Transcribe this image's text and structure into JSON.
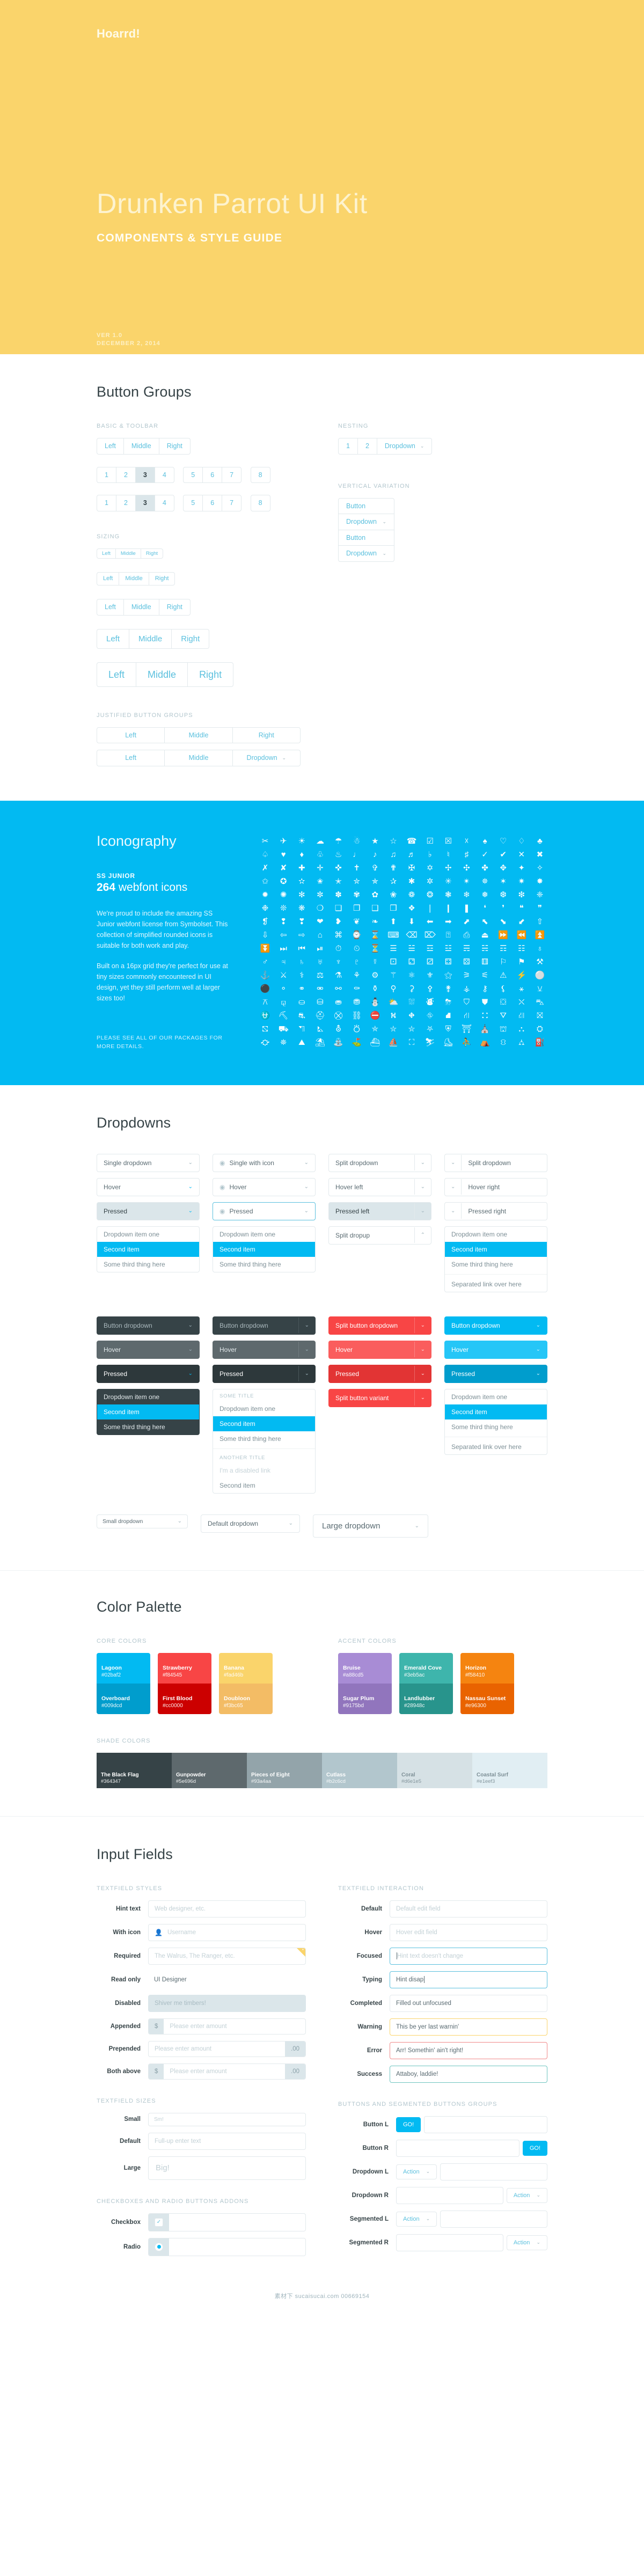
{
  "hero": {
    "logo": "Hoarrd!",
    "title": "Drunken Parrot UI Kit",
    "subtitle": "COMPONENTS & STYLE GUIDE",
    "version": "VER 1.0",
    "date": "DECEMBER 2, 2014"
  },
  "buttons": {
    "section_title": "Button Groups",
    "labels": {
      "basic": "BASIC & TOOLBAR",
      "nesting": "NESTING",
      "vertical": "VERTICAL VARIATION",
      "sizing": "SIZING",
      "justified": "JUSTIFIED BUTTON GROUPS"
    },
    "lmr": [
      "Left",
      "Middle",
      "Right"
    ],
    "toolbar_a": [
      "1",
      "2",
      "3",
      "4"
    ],
    "toolbar_b": [
      "5",
      "6",
      "7"
    ],
    "toolbar_c": [
      "8"
    ],
    "active_index": 2,
    "nesting": [
      "1",
      "2"
    ],
    "nesting_dropdown": "Dropdown",
    "vertical_items": [
      "Button",
      "Dropdown",
      "Button",
      "Dropdown"
    ],
    "justified_a": [
      "Left",
      "Middle",
      "Right"
    ],
    "justified_b": [
      "Left",
      "Middle",
      "Dropdown"
    ]
  },
  "iconography": {
    "title": "Iconography",
    "family": "SS JUNIOR",
    "count_number": "264",
    "count_suffix": " webfont icons",
    "paragraph_1": "We're proud to include the amazing SS Junior webfont license from Symbolset. This collection of simplified rounded icons is suitable for both work and play.",
    "paragraph_2": "Built on a 16px grid they're perfect for use at tiny sizes commonly encountered in UI design, yet they still perform well at larger sizes too!",
    "footer": "PLEASE SEE ALL OF OUR PACKAGES FOR MORE DETAILS.",
    "glyphs": [
      "✂",
      "✈",
      "☀",
      "☁",
      "☂",
      "☃",
      "★",
      "☆",
      "☎",
      "☑",
      "☒",
      "☓",
      "♠",
      "♡",
      "♢",
      "♣",
      "♤",
      "♥",
      "♦",
      "♧",
      "♨",
      "♩",
      "♪",
      "♫",
      "♬",
      "♭",
      "♮",
      "♯",
      "✓",
      "✔",
      "✕",
      "✖",
      "✗",
      "✘",
      "✚",
      "✛",
      "✜",
      "✝",
      "✞",
      "✟",
      "✠",
      "✡",
      "✢",
      "✣",
      "✤",
      "✥",
      "✦",
      "✧",
      "✩",
      "✪",
      "✫",
      "✬",
      "✭",
      "✮",
      "✯",
      "✰",
      "✱",
      "✲",
      "✳",
      "✴",
      "✵",
      "✶",
      "✷",
      "✸",
      "✹",
      "✺",
      "✻",
      "✼",
      "✽",
      "✾",
      "✿",
      "❀",
      "❁",
      "❂",
      "❃",
      "❄",
      "❅",
      "❆",
      "❇",
      "❈",
      "❉",
      "❊",
      "❋",
      "❍",
      "❏",
      "❐",
      "❑",
      "❒",
      "❖",
      "❘",
      "❙",
      "❚",
      "❛",
      "❜",
      "❝",
      "❞",
      "❡",
      "❢",
      "❣",
      "❤",
      "❥",
      "❦",
      "❧",
      "⬆",
      "⬇",
      "⬅",
      "➡",
      "⬈",
      "⬉",
      "⬊",
      "⬋",
      "⇧",
      "⇩",
      "⇦",
      "⇨",
      "⌂",
      "⌘",
      "⌚",
      "⌛",
      "⌨",
      "⌫",
      "⌦",
      "⍰",
      "⎙",
      "⏏",
      "⏩",
      "⏪",
      "⏫",
      "⏬",
      "⏭",
      "⏮",
      "⏯",
      "⏱",
      "⏲",
      "⏳",
      "☰",
      "☱",
      "☲",
      "☳",
      "☴",
      "☵",
      "☶",
      "☷",
      "♁",
      "♂",
      "♃",
      "♄",
      "♅",
      "♆",
      "♇",
      "☿",
      "⚀",
      "⚁",
      "⚂",
      "⚃",
      "⚄",
      "⚅",
      "⚐",
      "⚑",
      "⚒",
      "⚓",
      "⚔",
      "⚕",
      "⚖",
      "⚗",
      "⚘",
      "⚙",
      "⚚",
      "⚛",
      "⚜",
      "⚝",
      "⚞",
      "⚟",
      "⚠",
      "⚡",
      "⚪",
      "⚫",
      "⚬",
      "⚭",
      "⚮",
      "⚯",
      "⚰",
      "⚱",
      "⚲",
      "⚳",
      "⚴",
      "⚵",
      "⚶",
      "⚷",
      "⚸",
      "⚹",
      "⚺",
      "⚻",
      "⚼",
      "⛀",
      "⛁",
      "⛂",
      "⛃",
      "⛄",
      "⛅",
      "⛆",
      "⛇",
      "⛈",
      "⛉",
      "⛊",
      "⛋",
      "⛌",
      "⛍",
      "⛎",
      "⛏",
      "⛐",
      "⛑",
      "⛒",
      "⛓",
      "⛔",
      "⛕",
      "⛖",
      "⛗",
      "⛘",
      "⛙",
      "⛚",
      "⛛",
      "⛜",
      "⛝",
      "⛞",
      "⛟",
      "⛠",
      "⛡",
      "⛢",
      "⛣",
      "⛤",
      "⛥",
      "⛦",
      "⛧",
      "⛨",
      "⛩",
      "⛪",
      "⛫",
      "⛬",
      "⛭",
      "⛮",
      "⛯",
      "⛰",
      "⛱",
      "⛲",
      "⛳",
      "⛴",
      "⛵",
      "⛶",
      "⛷",
      "⛸",
      "⛹",
      "⛺",
      "⛻",
      "⛼",
      "⛽",
      "⛾",
      "⛿",
      "✁",
      "✂",
      "✃",
      "✄"
    ]
  },
  "dropdowns": {
    "section_title": "Dropdowns",
    "col1": [
      "Single dropdown",
      "Hover",
      "Pressed"
    ],
    "col2": [
      "Single with icon",
      "Hover",
      "Pressed"
    ],
    "col3": [
      "Split dropdown",
      "Hover left",
      "Pressed left",
      "Split dropup"
    ],
    "col4": [
      "Split dropdown",
      "Hover right",
      "Pressed right"
    ],
    "menu_items": [
      "Dropdown item one",
      "Second item",
      "Some third thing here"
    ],
    "menu_selected_index": 1,
    "split_link": "Separated link over here",
    "dark": [
      "Button dropdown",
      "Hover",
      "Pressed"
    ],
    "blue": [
      "Button dropdown",
      "Hover",
      "Pressed"
    ],
    "red_split": [
      "Split button dropdown",
      "Hover",
      "Pressed"
    ],
    "red_variant": "Split button variant",
    "titled_menu": {
      "title_1": "SOME TITLE",
      "title_2": "ANOTHER TITLE",
      "items_1": [
        "Dropdown item one",
        "Second item",
        "Some third thing here"
      ],
      "items_2": [
        "I'm a disabled link",
        "Second item"
      ]
    },
    "sizes": [
      "Small dropdown",
      "Default dropdown",
      "Large dropdown"
    ]
  },
  "palette": {
    "section_title": "Color Palette",
    "labels": {
      "core": "CORE COLORS",
      "accent": "ACCENT COLORS",
      "shade": "SHADE COLORS"
    },
    "core": [
      {
        "top_name": "Lagoon",
        "top_hex": "#02baf2",
        "bottom_name": "Overboard",
        "bottom_hex": "#009dcd"
      },
      {
        "top_name": "Strawberry",
        "top_hex": "#f84545",
        "bottom_name": "First Blood",
        "bottom_hex": "#cc0000"
      },
      {
        "top_name": "Banana",
        "top_hex": "#fad46b",
        "bottom_name": "Doubloon",
        "bottom_hex": "#f3bc65"
      }
    ],
    "accent": [
      {
        "top_name": "Bruise",
        "top_hex": "#a88cd5",
        "bottom_name": "Sugar Plum",
        "bottom_hex": "#9175bd"
      },
      {
        "top_name": "Emerald Cove",
        "top_hex": "#3eb5ac",
        "bottom_name": "Landlubber",
        "bottom_hex": "#28948c"
      },
      {
        "top_name": "Horizon",
        "top_hex": "#f58410",
        "bottom_name": "Nassau Sunset",
        "bottom_hex": "#e96300"
      }
    ],
    "shades": [
      {
        "name": "The Black Flag",
        "hex": "#364347"
      },
      {
        "name": "Gunpowder",
        "hex": "#5e696d"
      },
      {
        "name": "Pieces of Eight",
        "hex": "#93a4aa"
      },
      {
        "name": "Cutlass",
        "hex": "#b2c6cd"
      },
      {
        "name": "Coral",
        "hex": "#d6e1e5"
      },
      {
        "name": "Coastal Surf",
        "hex": "#e1eef3"
      }
    ]
  },
  "inputs": {
    "section_title": "Input Fields",
    "labels": {
      "styles": "TEXTFIELD STYLES",
      "interaction": "TEXTFIELD INTERACTION",
      "sizes": "TEXTFIELD SIZES",
      "buttons": "BUTTONS AND SEGMENTED BUTTONS GROUPS",
      "checks": "CHECKBOXES AND RADIO BUTTONS ADDONS"
    },
    "styles": [
      {
        "label": "Hint text",
        "value": "Web designer, etc.",
        "state": "placeholder"
      },
      {
        "label": "With icon",
        "value": "Username",
        "state": "placeholder",
        "icon": "user-icon"
      },
      {
        "label": "Required",
        "value": "The Walrus, The Ranger, etc.",
        "state": "required"
      },
      {
        "label": "Read only",
        "value": "UI Designer",
        "state": "readonly"
      },
      {
        "label": "Disabled",
        "value": "Shiver me timbers!",
        "state": "disabled"
      },
      {
        "label": "Appended",
        "value": "Please enter amount",
        "state": "placeholder",
        "prefix": "$"
      },
      {
        "label": "Prepended",
        "value": "Please enter amount",
        "state": "placeholder",
        "suffix": ".00"
      },
      {
        "label": "Both above",
        "value": "Please enter amount",
        "state": "placeholder",
        "prefix": "$",
        "suffix": ".00"
      }
    ],
    "interaction": [
      {
        "label": "Default",
        "value": "Default edit field",
        "state": "placeholder"
      },
      {
        "label": "Hover",
        "value": "Hover edit field",
        "state": "placeholder"
      },
      {
        "label": "Focused",
        "value": "Hint text doesn't change",
        "state": "focus"
      },
      {
        "label": "Typing",
        "value": "Hint disap",
        "state": "typing"
      },
      {
        "label": "Completed",
        "value": "Filled out unfocused",
        "state": "filled"
      },
      {
        "label": "Warning",
        "value": "This be yer last warnin'",
        "state": "warning"
      },
      {
        "label": "Error",
        "value": "Arr! Somethin' ain't right!",
        "state": "error"
      },
      {
        "label": "Success",
        "value": "Attaboy, laddie!",
        "state": "success"
      }
    ],
    "sizes": [
      {
        "label": "Small",
        "value": "Sm!"
      },
      {
        "label": "Default",
        "value": "Full-up enter text"
      },
      {
        "label": "Large",
        "value": "Big!"
      }
    ],
    "checks": [
      {
        "label": "Checkbox",
        "type": "checkbox",
        "checked": true
      },
      {
        "label": "Radio",
        "type": "radio",
        "checked": true
      }
    ],
    "buttons_rows": [
      {
        "label": "Button L",
        "btn": "GO!",
        "side": "left",
        "style": "blue"
      },
      {
        "label": "Button R",
        "btn": "GO!",
        "side": "right",
        "style": "blue"
      },
      {
        "label": "Dropdown L",
        "btn": "Action",
        "side": "left",
        "style": "dropdown"
      },
      {
        "label": "Dropdown R",
        "btn": "Action",
        "side": "right",
        "style": "dropdown"
      },
      {
        "label": "Segmented L",
        "btn": "Action",
        "side": "left",
        "style": "segmented"
      },
      {
        "label": "Segmented R",
        "btn": "Action",
        "side": "right",
        "style": "segmented"
      }
    ]
  },
  "watermark": "素材下 sucaisucai.com  00669154"
}
